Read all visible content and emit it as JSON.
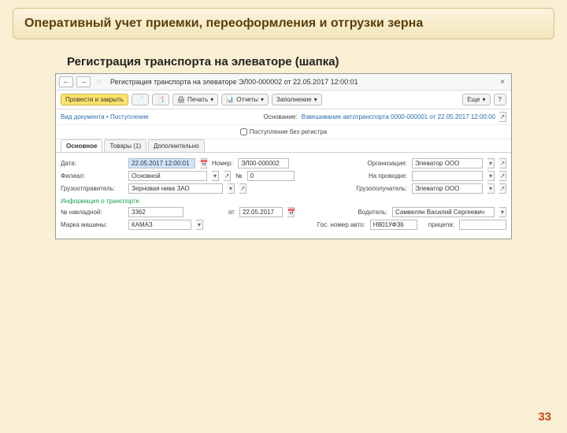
{
  "slide": {
    "title": "Оперативный учет приемки, переоформления и отгрузки зерна",
    "subtitle": "Регистрация транспорта на элеваторе (шапка)",
    "page": "33"
  },
  "window": {
    "back": "←",
    "fwd": "→",
    "star": "☆",
    "title": "Регистрация транспорта на элеваторе ЭЛ00-000002 от 22.05.2017 12:00:01",
    "close": "×",
    "toolbar": {
      "primary": "Провести и закрыть",
      "save": "📄",
      "post": "📑",
      "print": "Печать",
      "reports": "Отчеты",
      "fill": "Заполнение",
      "more": "Еще",
      "help": "?"
    },
    "cmd": {
      "left": "Вид документа • Поступление",
      "basis_label": "Основание:",
      "basis_value": "Взвешивание автотранспорта 0000-000001 от 22.05.2017 12:00:00"
    },
    "chk_label": "Поступление без регистра",
    "tabs": [
      "Основное",
      "Товары (1)",
      "Дополнительно"
    ],
    "form": {
      "date_l": "Дата:",
      "date_v": "22.05.2017 12:00:01",
      "num_l": "Номер:",
      "num_v": "ЭЛ00-000002",
      "org_l": "Организация:",
      "org_v": "Элеватор ООО",
      "fil_l": "Филиал:",
      "fil_v": "Основной",
      "n_l": "№",
      "n_v": "0",
      "na_l": "На проводке:",
      "send_l": "Грузоотправитель:",
      "send_v": "Зерновая нива ЗАО",
      "recv_l": "Грузополучатель:",
      "recv_v": "Элеватор ООО",
      "section": "Информация о транспорте",
      "nakl_l": "№ накладной:",
      "nakl_v": "3362",
      "ot_l": "от",
      "ot_v": "22.05.2017",
      "drv_l": "Водитель:",
      "drv_v": "Самвелян Василий Сергеевич",
      "brand_l": "Марка машины:",
      "brand_v": "КАМАЗ",
      "auto_l": "Гос. номер авто:",
      "auto_v": "Н801УФ36",
      "trail_l": "прицепа:"
    }
  }
}
